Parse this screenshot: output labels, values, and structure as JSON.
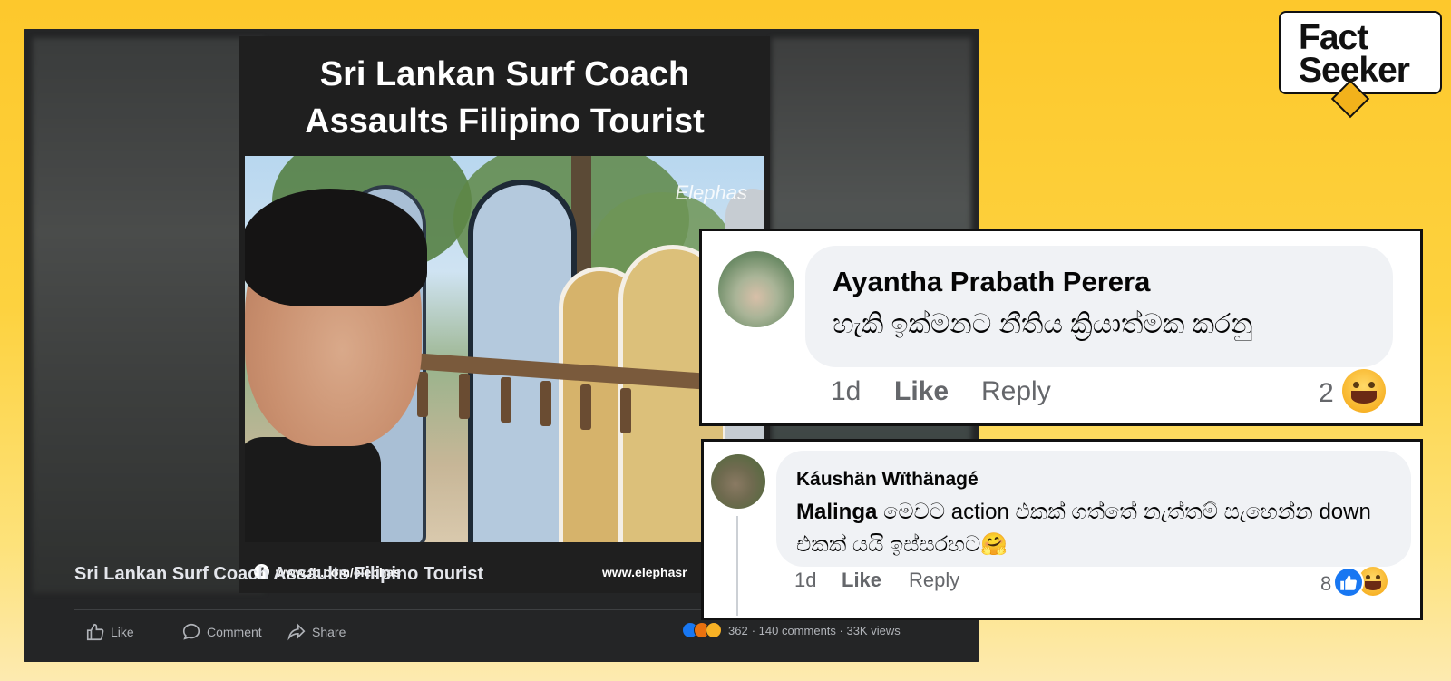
{
  "post": {
    "video_title": "Sri Lankan Surf Coach\nAssaults Filipino Tourist",
    "watermark": "Elephas",
    "fb_url": "www.fb.com/elephas",
    "site_url": "www.elephasr",
    "caption": "Sri Lankan Surf Coach Assaults Filipino Tourist",
    "actions": {
      "like": "Like",
      "comment": "Comment",
      "share": "Share"
    },
    "reaction_count": "362",
    "stats": "· 140 comments · 33K views",
    "colors": {
      "background": "#242526",
      "text": "#e4e6eb",
      "secondary_text": "#b0b3b8"
    }
  },
  "logo": {
    "line1": "Fact",
    "line2": "Seeker"
  },
  "comments": [
    {
      "author": "Ayantha Prabath Perera",
      "text": "හැකි ඉක්මනට නීතිය ක්‍රියාත්මක කරනු",
      "time": "1d",
      "like_label": "Like",
      "reply_label": "Reply",
      "reaction_count": "2",
      "reactions": [
        "haha-icon"
      ]
    },
    {
      "author": "Káushän Wïthänagé",
      "mention": "Malinga",
      "text": " මෙවට action එකක් ගත්තේ නැත්තම් සැහෙන්න down එකක් යයි ඉස්සරහට🤗",
      "time": "1d",
      "like_label": "Like",
      "reply_label": "Reply",
      "reaction_count": "8",
      "reactions": [
        "like-icon",
        "haha-icon"
      ]
    }
  ],
  "theme": {
    "page_background": "#fdc82c",
    "facebook_blue": "#1877f2"
  }
}
